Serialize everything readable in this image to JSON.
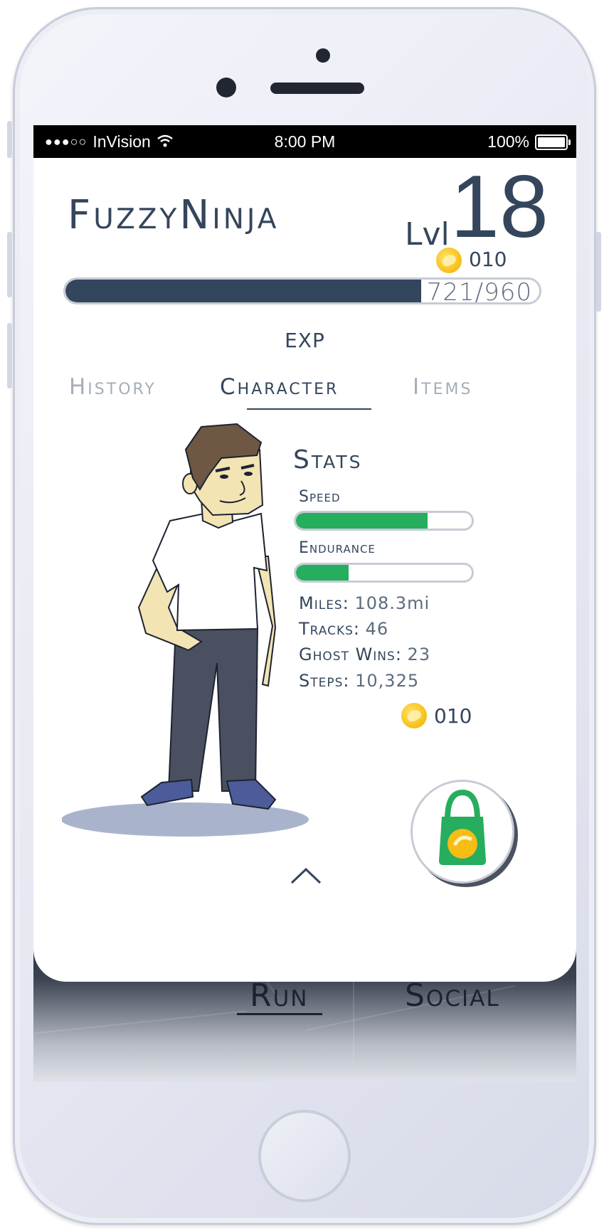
{
  "status_bar": {
    "carrier": "InVision",
    "time": "8:00 PM",
    "battery": "100%"
  },
  "profile": {
    "username": "FuzzyNinja",
    "level_label": "Lvl",
    "level": "18",
    "coins": "010"
  },
  "exp": {
    "current": 721,
    "max": 960,
    "text": "721/960",
    "label": "EXP"
  },
  "tabs": [
    {
      "label": "History",
      "active": false
    },
    {
      "label": "Character",
      "active": true
    },
    {
      "label": "Items",
      "active": false
    }
  ],
  "stats": {
    "title": "Stats",
    "speed_label": "Speed",
    "speed_fraction": 0.75,
    "endurance_label": "Endurance",
    "endurance_fraction": 0.3,
    "miles_label": "Miles:",
    "miles": "108.3mi",
    "tracks_label": "Tracks:",
    "tracks": "46",
    "ghost_wins_label": "Ghost Wins:",
    "ghost_wins": "23",
    "steps_label": "Steps:",
    "steps": "10,325"
  },
  "shop": {
    "coins": "010"
  },
  "bottom_nav": {
    "run": "Run",
    "social": "Social"
  },
  "colors": {
    "primary": "#34465c",
    "accent_green": "#26ad5e",
    "coin": "#f6bd15"
  }
}
